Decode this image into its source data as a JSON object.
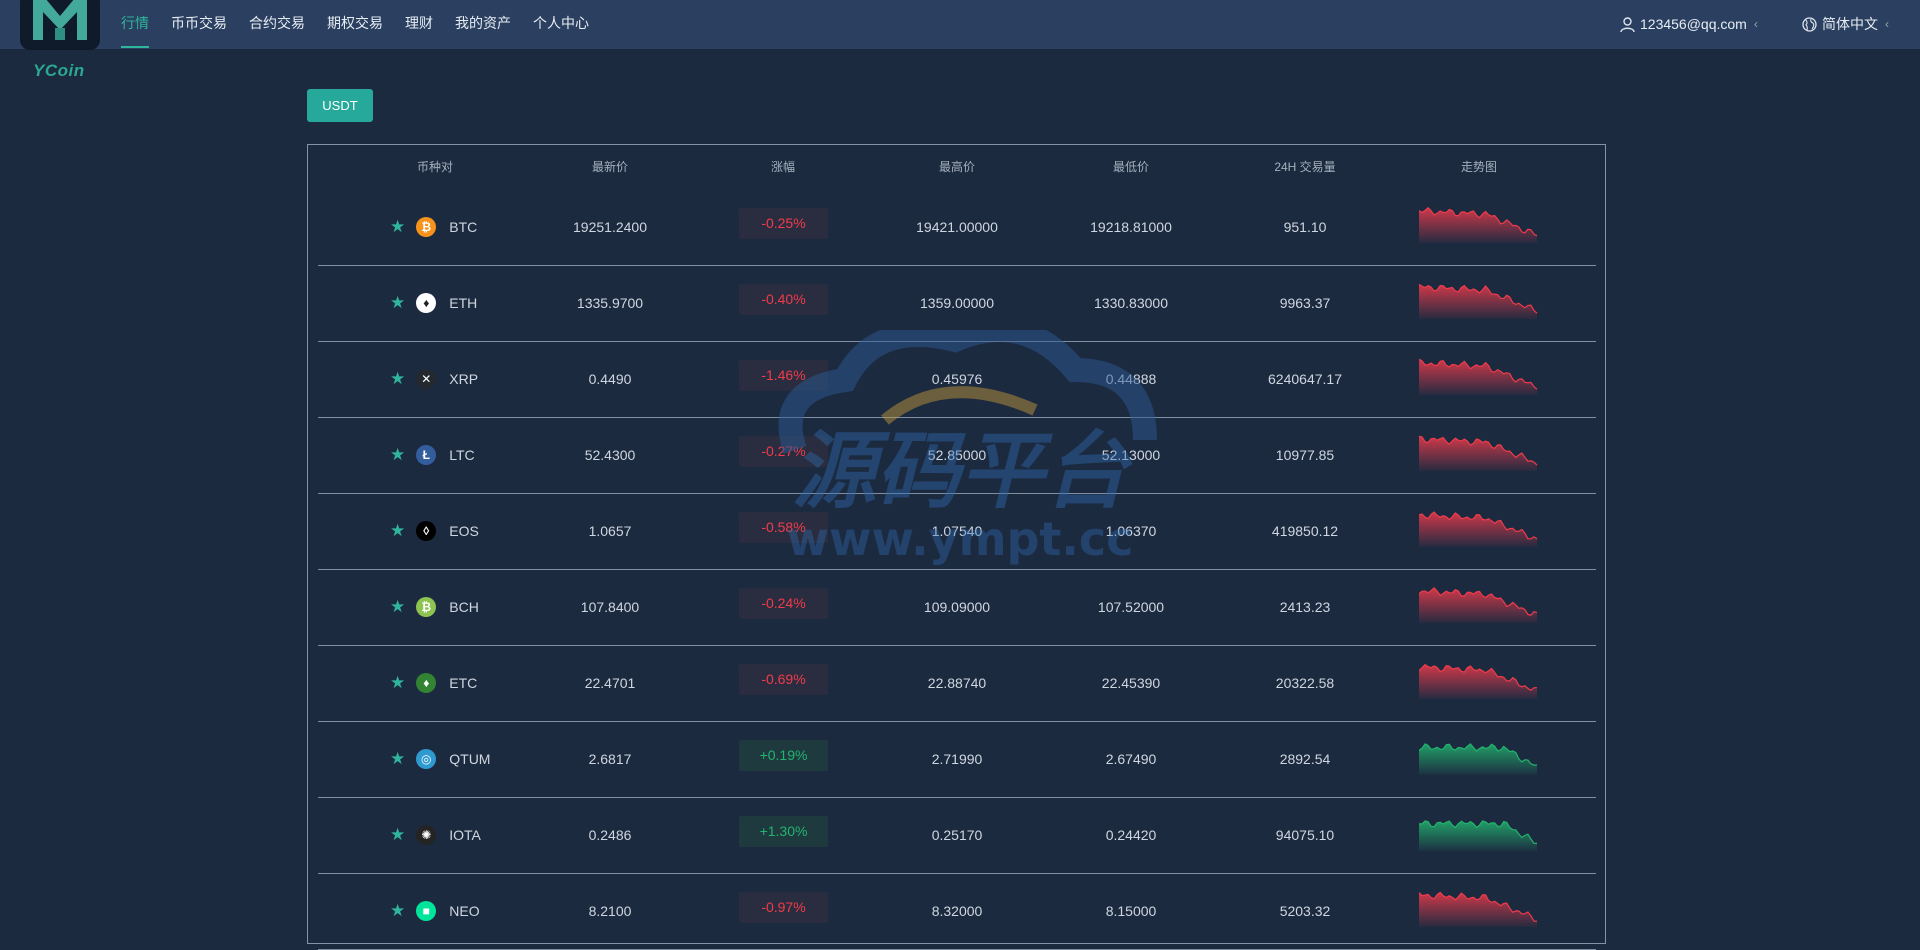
{
  "brand": {
    "name": "YCoin"
  },
  "nav": {
    "items": [
      "行情",
      "币币交易",
      "合约交易",
      "期权交易",
      "理财",
      "我的资产",
      "个人中心"
    ],
    "active_index": 0
  },
  "user": {
    "email": "123456@qq.com"
  },
  "language": {
    "label": "简体中文"
  },
  "quote_tab": {
    "label": "USDT"
  },
  "table": {
    "headers": [
      "币种对",
      "最新价",
      "涨幅",
      "最高价",
      "最低价",
      "24H 交易量",
      "走势图"
    ],
    "rows": [
      {
        "symbol": "BTC",
        "price": "19251.2400",
        "change": "-0.25%",
        "high": "19421.00000",
        "low": "19218.81000",
        "volume": "951.10",
        "trend": "down",
        "icon_color": "#f7931a",
        "icon_glyph": "₿"
      },
      {
        "symbol": "ETH",
        "price": "1335.9700",
        "change": "-0.40%",
        "high": "1359.00000",
        "low": "1330.83000",
        "volume": "9963.37",
        "trend": "down",
        "icon_color": "#ffffff",
        "icon_glyph": "♦"
      },
      {
        "symbol": "XRP",
        "price": "0.4490",
        "change": "-1.46%",
        "high": "0.45976",
        "low": "0.44888",
        "volume": "6240647.17",
        "trend": "down",
        "icon_color": "#23292f",
        "icon_glyph": "✕"
      },
      {
        "symbol": "LTC",
        "price": "52.4300",
        "change": "-0.27%",
        "high": "52.85000",
        "low": "52.13000",
        "volume": "10977.85",
        "trend": "down",
        "icon_color": "#345d9d",
        "icon_glyph": "Ł"
      },
      {
        "symbol": "EOS",
        "price": "1.0657",
        "change": "-0.58%",
        "high": "1.07540",
        "low": "1.06370",
        "volume": "419850.12",
        "trend": "down",
        "icon_color": "#000000",
        "icon_glyph": "◊"
      },
      {
        "symbol": "BCH",
        "price": "107.8400",
        "change": "-0.24%",
        "high": "109.09000",
        "low": "107.52000",
        "volume": "2413.23",
        "trend": "down",
        "icon_color": "#8dc351",
        "icon_glyph": "₿"
      },
      {
        "symbol": "ETC",
        "price": "22.4701",
        "change": "-0.69%",
        "high": "22.88740",
        "low": "22.45390",
        "volume": "20322.58",
        "trend": "down",
        "icon_color": "#328332",
        "icon_glyph": "♦"
      },
      {
        "symbol": "QTUM",
        "price": "2.6817",
        "change": "+0.19%",
        "high": "2.71990",
        "low": "2.67490",
        "volume": "2892.54",
        "trend": "up",
        "icon_color": "#2e9ad0",
        "icon_glyph": "◎"
      },
      {
        "symbol": "IOTA",
        "price": "0.2486",
        "change": "+1.30%",
        "high": "0.25170",
        "low": "0.24420",
        "volume": "94075.10",
        "trend": "up",
        "icon_color": "#242424",
        "icon_glyph": "✺"
      },
      {
        "symbol": "NEO",
        "price": "8.2100",
        "change": "-0.97%",
        "high": "8.32000",
        "low": "8.15000",
        "volume": "5203.32",
        "trend": "down",
        "icon_color": "#00e599",
        "icon_glyph": "■"
      }
    ]
  },
  "watermark": {
    "title": "源码平台",
    "url": "www.ympt.cc"
  },
  "colors": {
    "accent": "#2fb59b",
    "up": "#22b46e",
    "down": "#f03b4b"
  }
}
